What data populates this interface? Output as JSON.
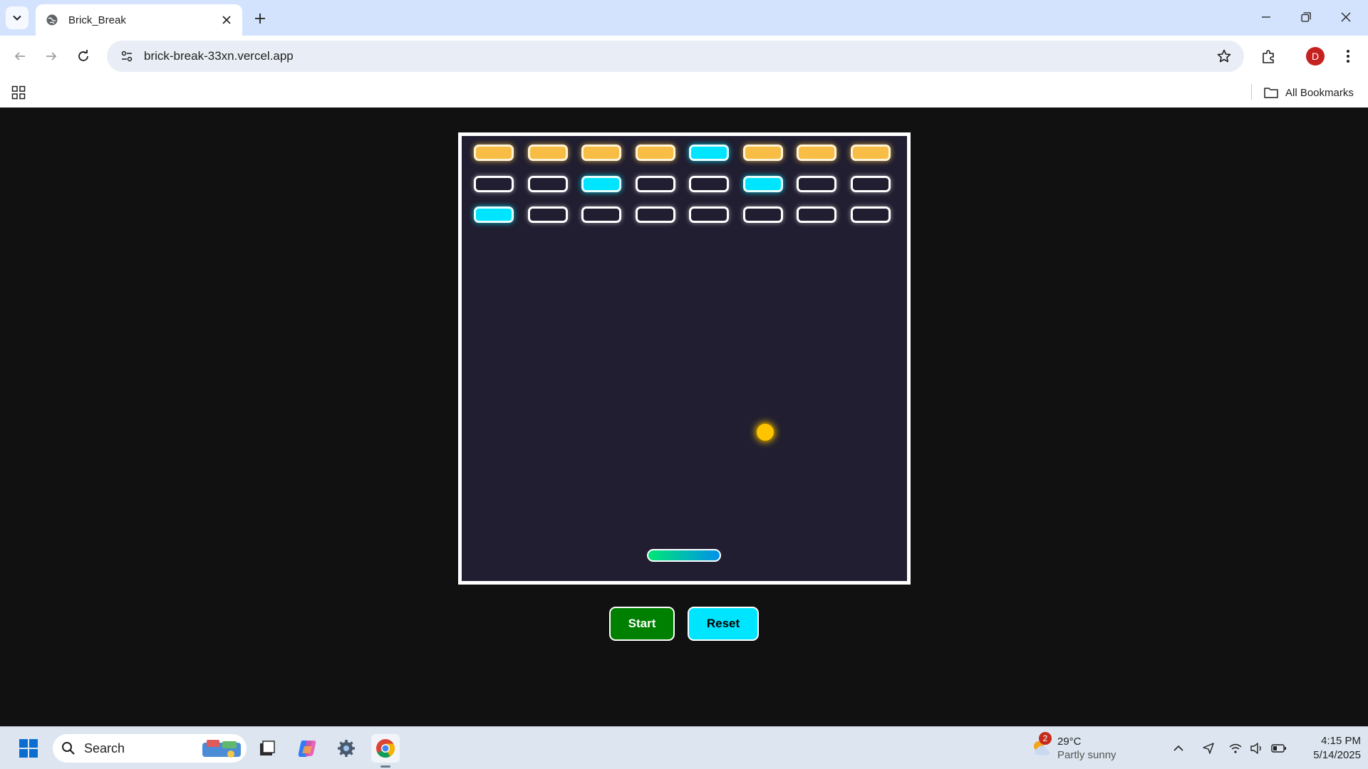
{
  "browser": {
    "tab_title": "Brick_Break",
    "url": "brick-break-33xn.vercel.app",
    "profile_initial": "D",
    "bookmarks_label": "All Bookmarks"
  },
  "game": {
    "board_border": "#ffffff",
    "board_background": "#201e30",
    "brick_rows": [
      [
        "orange",
        "orange",
        "orange",
        "orange",
        "cyan",
        "orange",
        "orange",
        "orange"
      ],
      [
        "empty",
        "empty",
        "cyan",
        "empty",
        "empty",
        "cyan",
        "empty",
        "empty"
      ],
      [
        "cyan",
        "empty",
        "empty",
        "empty",
        "empty",
        "empty",
        "empty",
        "empty"
      ]
    ],
    "colors": {
      "orange": "#f7bd45",
      "cyan": "#00e5ff",
      "ball": "#ffc400"
    },
    "buttons": {
      "start": "Start",
      "reset": "Reset"
    }
  },
  "taskbar": {
    "search_label": "Search",
    "weather_badge": "2",
    "weather_temp": "29°C",
    "weather_desc": "Partly sunny",
    "time": "4:15 PM",
    "date": "5/14/2025"
  }
}
